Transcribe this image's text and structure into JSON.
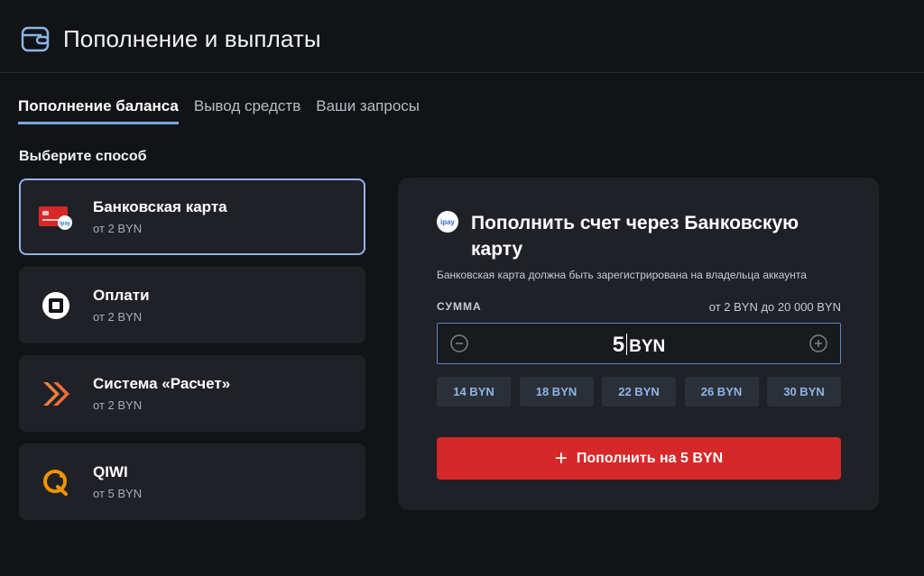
{
  "header": {
    "title": "Пополнение и выплаты",
    "icon": "wallet-icon"
  },
  "tabs": [
    {
      "label": "Пополнение баланса",
      "active": true
    },
    {
      "label": "Вывод средств",
      "active": false
    },
    {
      "label": "Ваши запросы",
      "active": false
    }
  ],
  "methods_section": {
    "label": "Выберите способ"
  },
  "methods": [
    {
      "name": "Банковская карта",
      "min": "от 2 BYN",
      "icon": "bank-card-icon",
      "selected": true
    },
    {
      "name": "Оплати",
      "min": "от 2 BYN",
      "icon": "oplati-icon",
      "selected": false
    },
    {
      "name": "Система «Расчет»",
      "min": "от 2 BYN",
      "icon": "raschet-icon",
      "selected": false
    },
    {
      "name": "QIWI",
      "min": "от 5 BYN",
      "icon": "qiwi-icon",
      "selected": false
    }
  ],
  "panel": {
    "logo_text": "ipay",
    "title": "Пополнить счет через Банковскую карту",
    "note": "Банковская карта должна быть зарегистрирована на владельца аккаунта",
    "amount_label": "СУММА",
    "amount_range": "от 2 BYN до 20 000 BYN",
    "amount_value": "5",
    "currency": "BYN",
    "presets": [
      "14 BYN",
      "18 BYN",
      "22 BYN",
      "26 BYN",
      "30 BYN"
    ],
    "submit_label": "Пополнить на 5 BYN",
    "submit_icon": "plus-icon"
  },
  "colors": {
    "background": "#111316",
    "card": "#1f2126",
    "accent": "#8fb5e8",
    "submit": "#d62828"
  }
}
